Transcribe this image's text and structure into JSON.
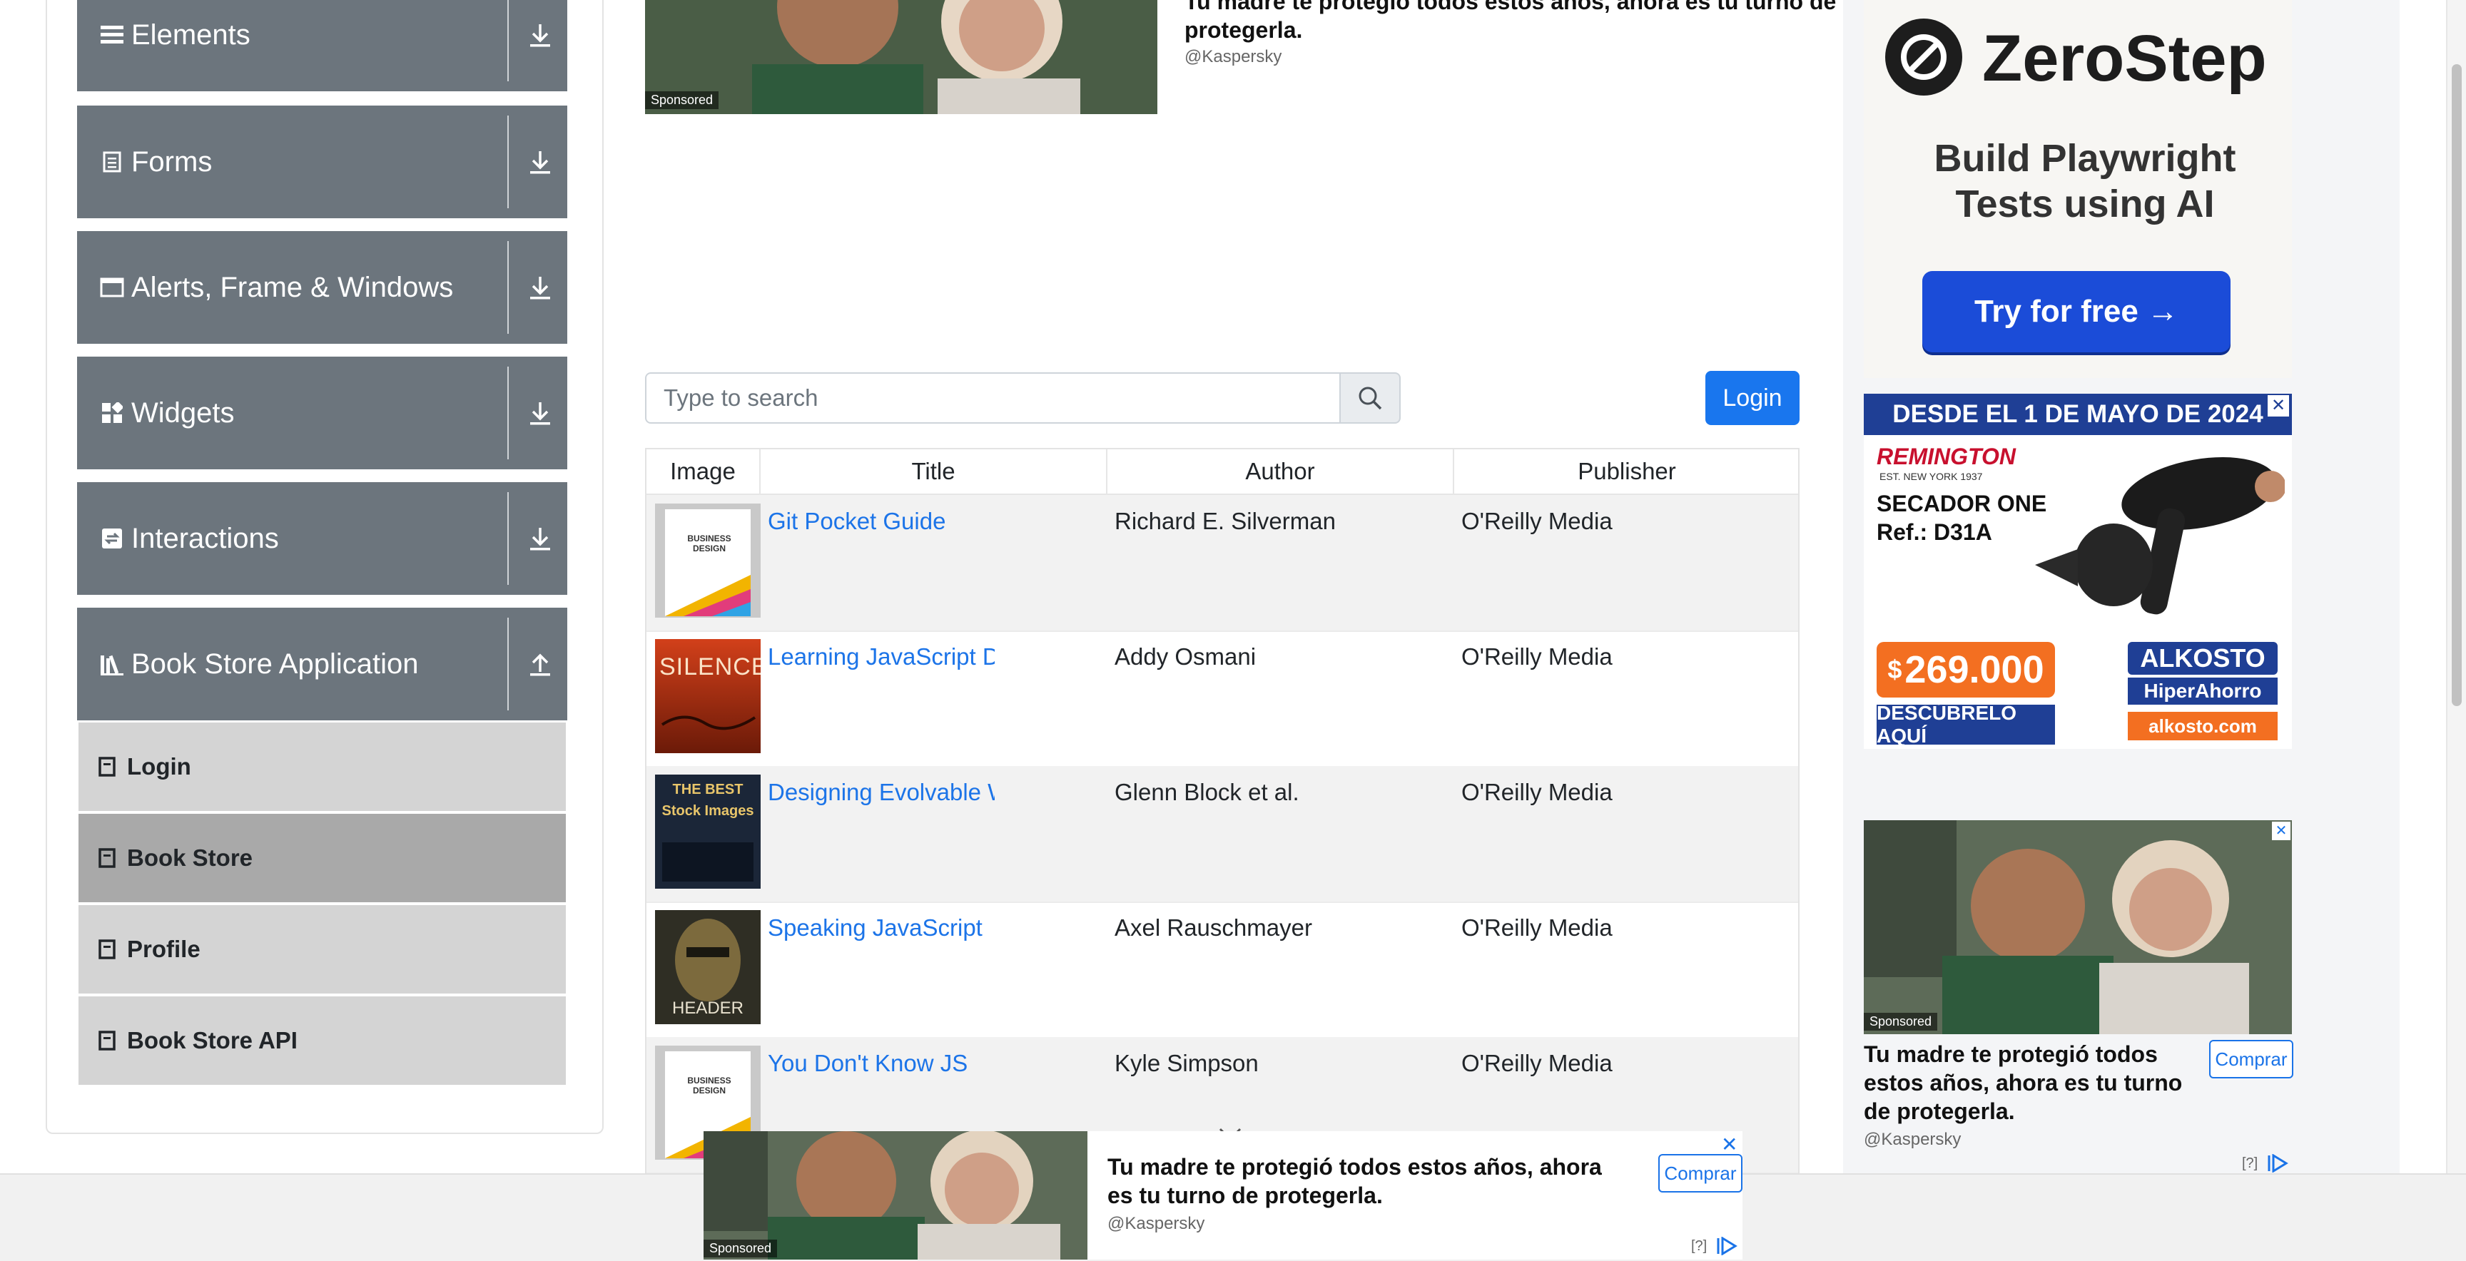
{
  "sidebar": {
    "groups": [
      {
        "label": "Elements",
        "icon": "hamburger-icon",
        "state": "collapsed"
      },
      {
        "label": "Forms",
        "icon": "document-icon",
        "state": "collapsed"
      },
      {
        "label": "Alerts, Frame & Windows",
        "icon": "window-icon",
        "state": "collapsed"
      },
      {
        "label": "Widgets",
        "icon": "grid-icon",
        "state": "collapsed"
      },
      {
        "label": "Interactions",
        "icon": "interactions-icon",
        "state": "collapsed"
      },
      {
        "label": "Book Store Application",
        "icon": "books-icon",
        "state": "expanded"
      }
    ],
    "bookstore_items": [
      {
        "label": "Login",
        "active": false
      },
      {
        "label": "Book Store",
        "active": true
      },
      {
        "label": "Profile",
        "active": false
      },
      {
        "label": "Book Store API",
        "active": false
      }
    ]
  },
  "top_ad": {
    "headline": "Tu madre te protegió todos estos años, ahora es tu turno de protegerla.",
    "handle": "@Kaspersky",
    "sponsored": "Sponsored"
  },
  "search": {
    "placeholder": "Type to search"
  },
  "login_button": "Login",
  "table": {
    "headers": [
      "Image",
      "Title",
      "Author",
      "Publisher"
    ],
    "rows": [
      {
        "title": "Git Pocket Guide",
        "author": "Richard E. Silverman",
        "publisher": "O'Reilly Media",
        "cover_text": "BUSINESS DESIGN"
      },
      {
        "title": "Learning JavaScript Design Patterns",
        "author": "Addy Osmani",
        "publisher": "O'Reilly Media",
        "cover_text": "SILENCE"
      },
      {
        "title": "Designing Evolvable Web APIs with ASP.NET",
        "author": "Glenn Block et al.",
        "publisher": "O'Reilly Media",
        "cover_text": "THE BEST Stock Images"
      },
      {
        "title": "Speaking JavaScript",
        "author": "Axel Rauschmayer",
        "publisher": "O'Reilly Media",
        "cover_text": "HEADER"
      },
      {
        "title": "You Don't Know JS",
        "author": "Kyle Simpson",
        "publisher": "O'Reilly Media",
        "cover_text": "BUSINESS DESIGN"
      }
    ]
  },
  "zerostep_ad": {
    "brand": "ZeroStep",
    "tagline": "Build Playwright Tests using AI",
    "cta": "Try for free →"
  },
  "alkosto_ad": {
    "banner": "DESDE EL 1 DE MAYO DE 2024",
    "brand": "REMINGTON",
    "brand_sub": "EST. NEW YORK 1937",
    "product": "SECADOR ONE",
    "ref": "Ref.: D31A",
    "price": "269.000",
    "currency": "$",
    "cta": "DESCÚBRELO AQUÍ",
    "store": "ALKOSTO",
    "store_sub": "HiperAhorro",
    "domain": "alkosto.com"
  },
  "side_kaspersky_ad": {
    "headline": "Tu madre te protegió todos estos años, ahora es tu turno de protegerla.",
    "handle": "@Kaspersky",
    "sponsored": "Sponsored",
    "cta": "Comprar",
    "help": "[?]"
  },
  "bottom_ad": {
    "headline": "Tu madre te protegió todos estos años, ahora es tu turno de protegerla.",
    "handle": "@Kaspersky",
    "sponsored": "Sponsored",
    "cta": "Comprar",
    "help": "[?]"
  },
  "colors": {
    "primary": "#1976ee",
    "sidebar": "#6c757d",
    "link": "#1c74e8",
    "alkosto_blue": "#1f3f95",
    "alkosto_orange": "#f36f21"
  }
}
